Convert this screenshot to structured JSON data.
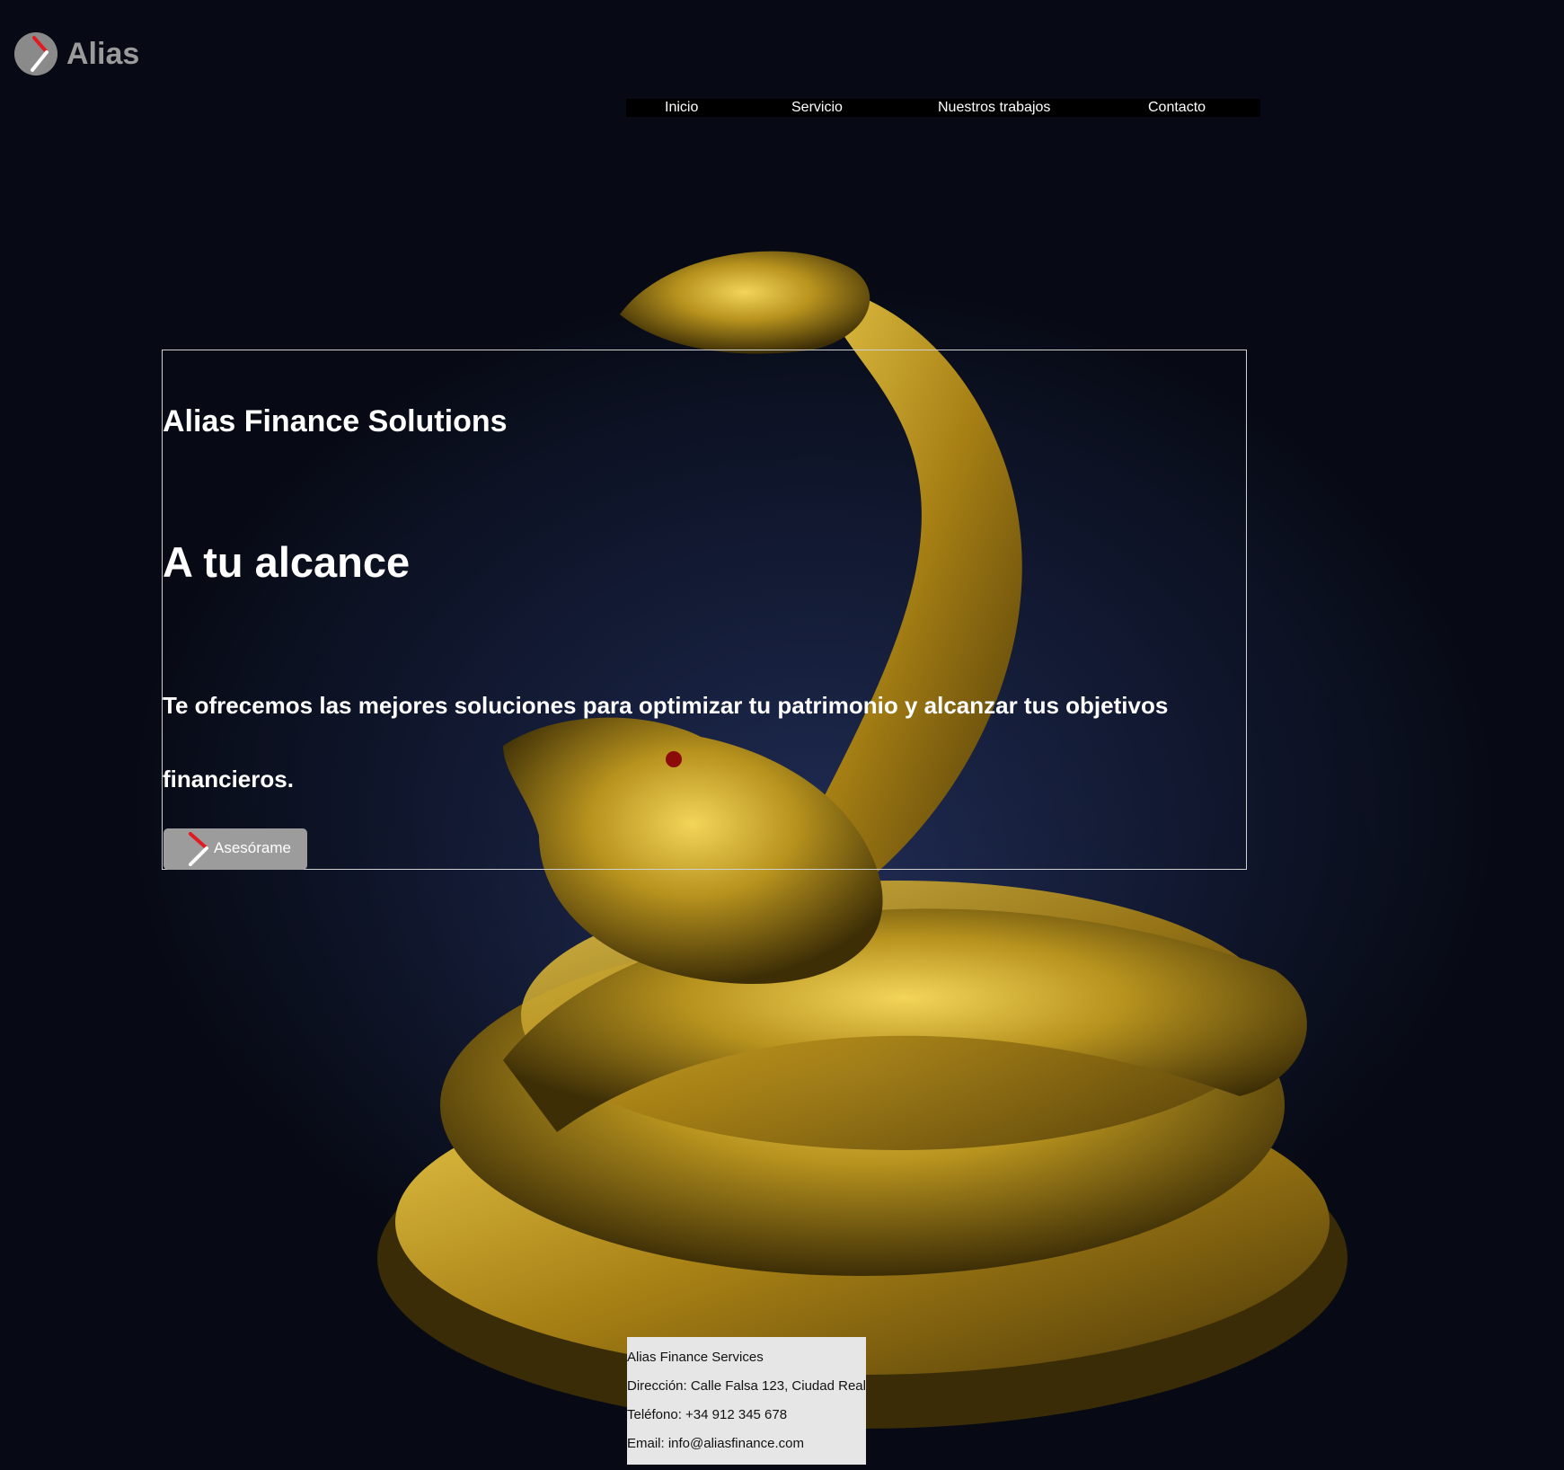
{
  "brand": {
    "name": "Alias",
    "colors": {
      "accent": "#e21b23",
      "logo_gray": "#8a8a8a",
      "background": "#0a0f1c",
      "gold": "#c9a227"
    }
  },
  "nav": {
    "items": [
      {
        "label": "Inicio"
      },
      {
        "label": "Servicio"
      },
      {
        "label": "Nuestros trabajos"
      },
      {
        "label": "Contacto"
      }
    ]
  },
  "hero": {
    "title": "Alias Finance Solutions",
    "heading": "A tu alcance",
    "description": "Te ofrecemos las mejores soluciones para optimizar tu patrimonio y alcanzar tus objetivos financieros.",
    "button_label": "Asesórame",
    "button_icon": "chevron-right-icon"
  },
  "background_image": {
    "subject": "golden snake and toad statue"
  },
  "footer": {
    "company": "Alias Finance Services",
    "address": "Dirección: Calle Falsa 123, Ciudad Real",
    "phone": "Teléfono: +34 912 345 678",
    "email": "Email: info@aliasfinance.com"
  }
}
